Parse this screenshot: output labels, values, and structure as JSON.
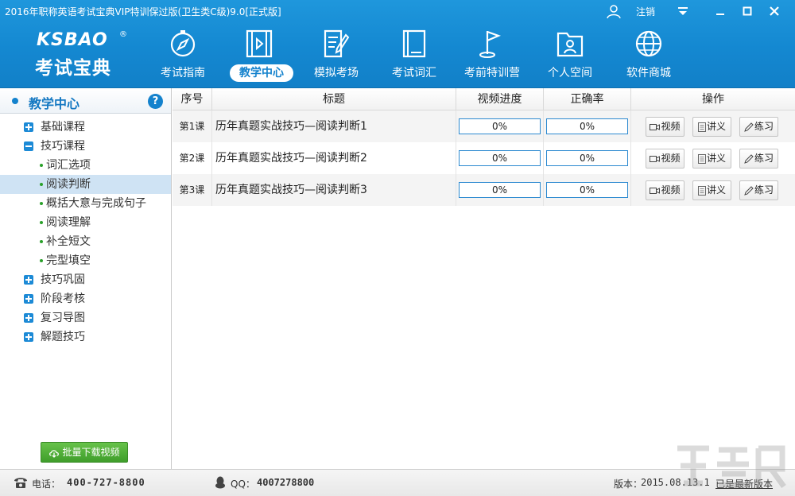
{
  "window": {
    "title": "2016年职称英语考试宝典VIP特训保过版(卫生类C级)9.0[正式版]",
    "logout_label": "注销"
  },
  "logo": {
    "en": "KSBAO",
    "reg": "®",
    "cn": "考试宝典"
  },
  "nav": {
    "items": [
      {
        "label": "考试指南",
        "icon": "compass-icon"
      },
      {
        "label": "教学中心",
        "icon": "video-film-icon",
        "active": true
      },
      {
        "label": "模拟考场",
        "icon": "exam-paper-icon"
      },
      {
        "label": "考试词汇",
        "icon": "book-icon"
      },
      {
        "label": "考前特训营",
        "icon": "flag-icon"
      },
      {
        "label": "个人空间",
        "icon": "user-folder-icon"
      },
      {
        "label": "软件商城",
        "icon": "globe-icon"
      }
    ]
  },
  "sidebar": {
    "title": "教学中心",
    "help": "?",
    "tree": [
      {
        "label": "基础课程",
        "type": "group",
        "expanded": false
      },
      {
        "label": "技巧课程",
        "type": "group",
        "expanded": true
      },
      {
        "label": "词汇选项",
        "type": "child"
      },
      {
        "label": "阅读判断",
        "type": "child",
        "selected": true
      },
      {
        "label": "概括大意与完成句子",
        "type": "child"
      },
      {
        "label": "阅读理解",
        "type": "child"
      },
      {
        "label": "补全短文",
        "type": "child"
      },
      {
        "label": "完型填空",
        "type": "child"
      },
      {
        "label": "技巧巩固",
        "type": "group",
        "expanded": false
      },
      {
        "label": "阶段考核",
        "type": "group",
        "expanded": false
      },
      {
        "label": "复习导图",
        "type": "group",
        "expanded": false
      },
      {
        "label": "解题技巧",
        "type": "group",
        "expanded": false
      }
    ],
    "download_label": "批量下载视频"
  },
  "table": {
    "headers": {
      "num": "序号",
      "title": "标题",
      "progress": "视频进度",
      "accuracy": "正确率",
      "actions": "操作"
    },
    "action_labels": {
      "video": "视频",
      "notes": "讲义",
      "practice": "练习"
    },
    "rows": [
      {
        "num": "第1课",
        "title": "历年真题实战技巧—阅读判断1",
        "progress": "0%",
        "accuracy": "0%"
      },
      {
        "num": "第2课",
        "title": "历年真题实战技巧—阅读判断2",
        "progress": "0%",
        "accuracy": "0%"
      },
      {
        "num": "第3课",
        "title": "历年真题实战技巧—阅读判断3",
        "progress": "0%",
        "accuracy": "0%"
      }
    ]
  },
  "footer": {
    "phone_label": "电话：",
    "phone": "400-727-8800",
    "qq_label": "QQ：",
    "qq": "4007278800",
    "version_label": "版本：",
    "version": "2015.08.13.1",
    "update_status": "已是最新版本"
  },
  "colors": {
    "header_blue": "#1488d1",
    "active_text": "#1482cd",
    "download_green": "#4aa834"
  }
}
